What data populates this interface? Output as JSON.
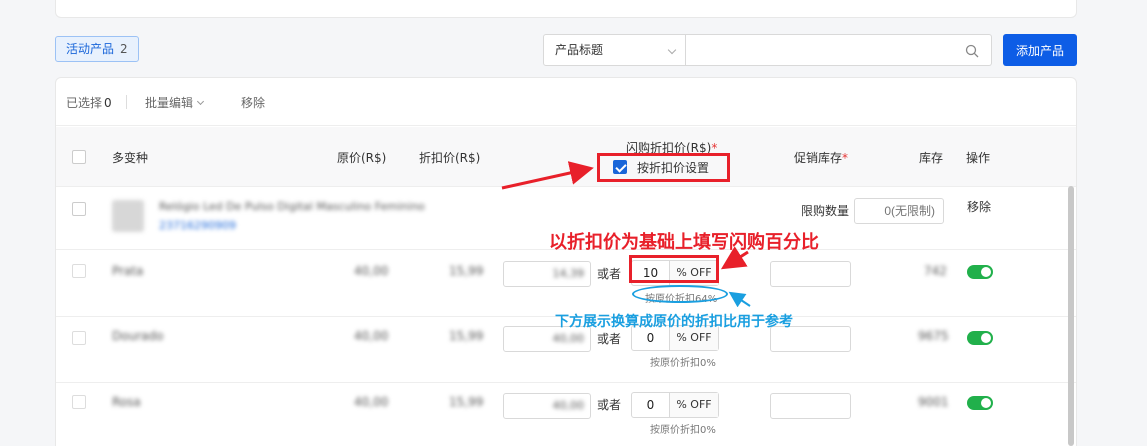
{
  "filter": {
    "active_label": "活动产品",
    "active_count": "2"
  },
  "search": {
    "field_label": "产品标题",
    "placeholder": ""
  },
  "toolbar": {
    "add_product": "添加产品",
    "selected_label": "已选择",
    "selected_count": "0",
    "bulk_edit": "批量编辑",
    "remove": "移除"
  },
  "table": {
    "headers": {
      "variants": "多变种",
      "original_price": "原价(R$)",
      "discount_price": "折扣价(R$)",
      "flash_price": "闪购折扣价(R$)",
      "promo_stock": "促销库存",
      "stock": "库存",
      "actions": "操作"
    },
    "by_discount_setting": "按折扣价设置",
    "product": {
      "name": "Relógio Led De Pulso Digital Masculino Feminino",
      "id": "23716290909",
      "limit_label": "限购数量",
      "limit_placeholder": "0(无限制)",
      "action": "移除"
    },
    "rows": [
      {
        "variant": "Prata",
        "original": "40,00",
        "discount": "15,99",
        "flash": "14,39",
        "or": "或者",
        "percent": "10",
        "unit": "% OFF",
        "hint": "按原价折扣64%",
        "promo_stock": "",
        "stock": "742"
      },
      {
        "variant": "Dourado",
        "original": "40,00",
        "discount": "15,99",
        "flash": "40,00",
        "or": "或者",
        "percent": "0",
        "unit": "% OFF",
        "hint": "按原价折扣0%",
        "promo_stock": "",
        "stock": "9675"
      },
      {
        "variant": "Rosa",
        "original": "40,00",
        "discount": "15,99",
        "flash": "40,00",
        "or": "或者",
        "percent": "0",
        "unit": "% OFF",
        "hint": "按原价折扣0%",
        "promo_stock": "",
        "stock": "9001"
      }
    ]
  },
  "annotations": {
    "red_note": "以折扣价为基础上填写闪购百分比",
    "blue_note": "下方展示换算成原价的折扣比用于参考"
  },
  "colors": {
    "primary": "#0d5de6",
    "toggle_on": "#21b04b",
    "annotation_red": "#e8202a",
    "annotation_blue": "#1a9fe0"
  }
}
